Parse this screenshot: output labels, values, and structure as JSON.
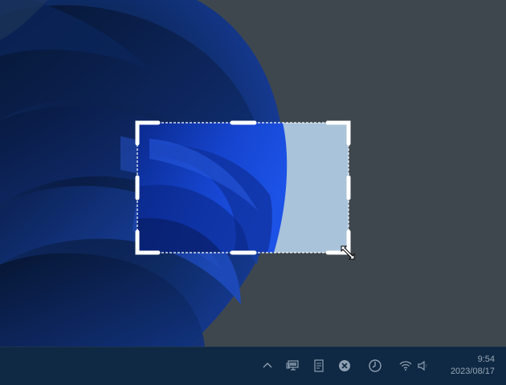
{
  "desktop": {
    "wallpaper": "windows-11-bloom",
    "colors": {
      "background": "#485159",
      "bloom_dark": "#0a1f4f",
      "bloom_mid": "#1a3f8c",
      "bloom_bright": "#1c4fd0",
      "selection_light": "#a9c3da",
      "taskbar": "#0f2843"
    }
  },
  "snip": {
    "handle_color": "#ffffff",
    "border_style": "dashed"
  },
  "taskbar": {
    "tray_icons": [
      "chevron-up-icon",
      "network-display-icon",
      "notepad-icon",
      "close-circle-icon",
      "clock-app-icon",
      "wifi-icon",
      "volume-icon"
    ],
    "clock": {
      "time": "9:54",
      "date": "2023/08/17"
    }
  }
}
